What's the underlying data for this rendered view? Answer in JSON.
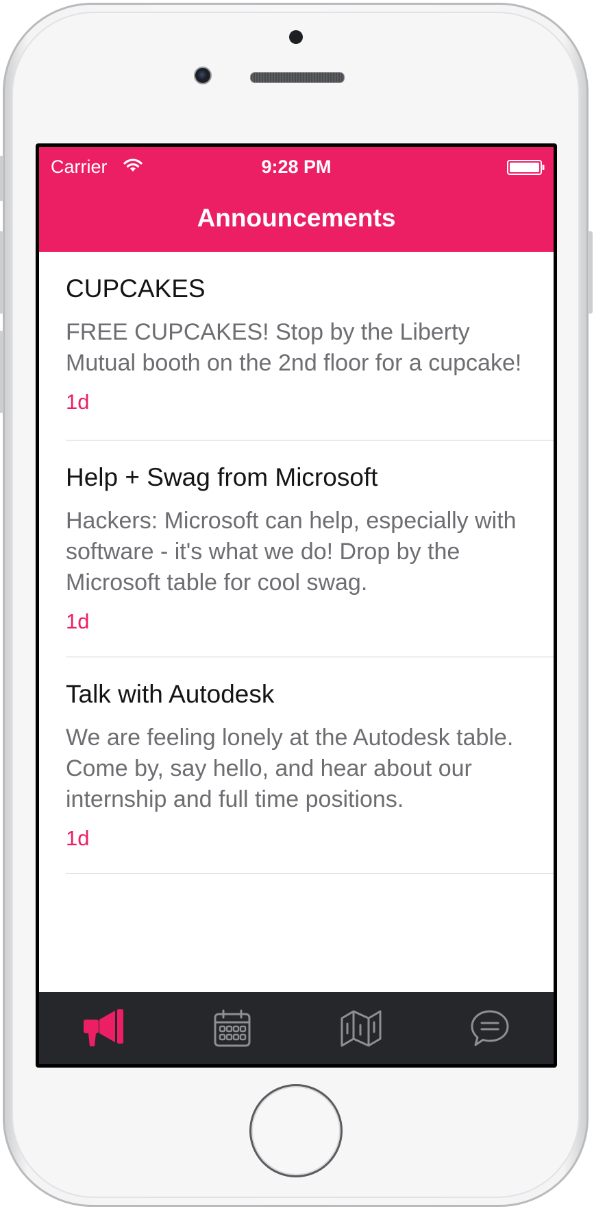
{
  "status_bar": {
    "carrier": "Carrier",
    "time": "9:28 PM",
    "wifi_icon": "wifi-icon",
    "battery_icon": "battery-icon"
  },
  "nav": {
    "title": "Announcements"
  },
  "announcements": [
    {
      "title": "CUPCAKES",
      "body": "FREE CUPCAKES! Stop by the Liberty Mutual booth on the 2nd floor for a cupcake!",
      "time": "1d"
    },
    {
      "title": "Help + Swag from Microsoft",
      "body": "Hackers: Microsoft can help, especially with software - it's what we do! Drop by the Microsoft table for cool swag.",
      "time": "1d"
    },
    {
      "title": "Talk with Autodesk",
      "body": "We are feeling lonely at the Autodesk table. Come by, say hello, and hear about our internship and full time positions.",
      "time": "1d"
    }
  ],
  "tab_bar": {
    "tabs": [
      {
        "icon": "megaphone-icon",
        "active": true
      },
      {
        "icon": "calendar-icon",
        "active": false
      },
      {
        "icon": "map-icon",
        "active": false
      },
      {
        "icon": "chat-bubble-icon",
        "active": false
      }
    ]
  },
  "colors": {
    "accent": "#ec1f64",
    "tabbar_bg": "#25272b",
    "inactive_icon": "#8e8f93",
    "title_text": "#141414",
    "body_text": "#6d6d72"
  }
}
